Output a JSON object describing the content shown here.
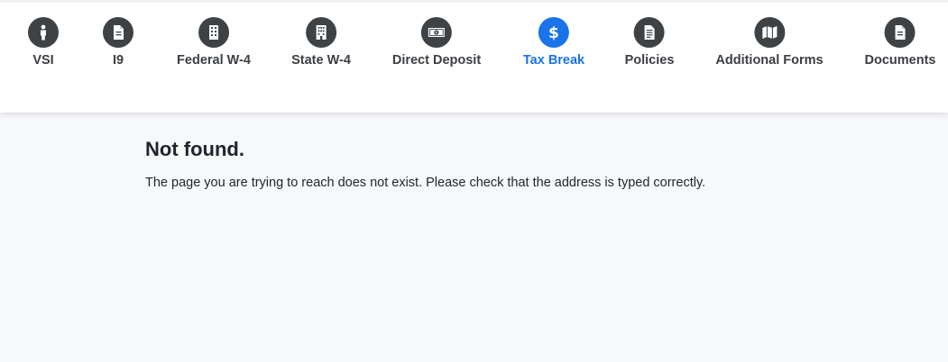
{
  "nav": {
    "items": [
      {
        "label": "VSI",
        "icon": "person-icon"
      },
      {
        "label": "I9",
        "icon": "document-icon"
      },
      {
        "label": "Federal W-4",
        "icon": "building-icon"
      },
      {
        "label": "State W-4",
        "icon": "office-building-icon"
      },
      {
        "label": "Direct Deposit",
        "icon": "money-icon"
      },
      {
        "label": "Tax Break",
        "icon": "dollar-icon"
      },
      {
        "label": "Policies",
        "icon": "file-text-icon"
      },
      {
        "label": "Additional Forms",
        "icon": "map-icon"
      },
      {
        "label": "Documents",
        "icon": "document-icon"
      }
    ],
    "active_item": "Tax Break",
    "colors": {
      "icon_bg": "#3f4245",
      "active": "#1a73e8"
    }
  },
  "main": {
    "title": "Not found.",
    "message": "The page you are trying to reach does not exist. Please check that the address is typed correctly."
  }
}
